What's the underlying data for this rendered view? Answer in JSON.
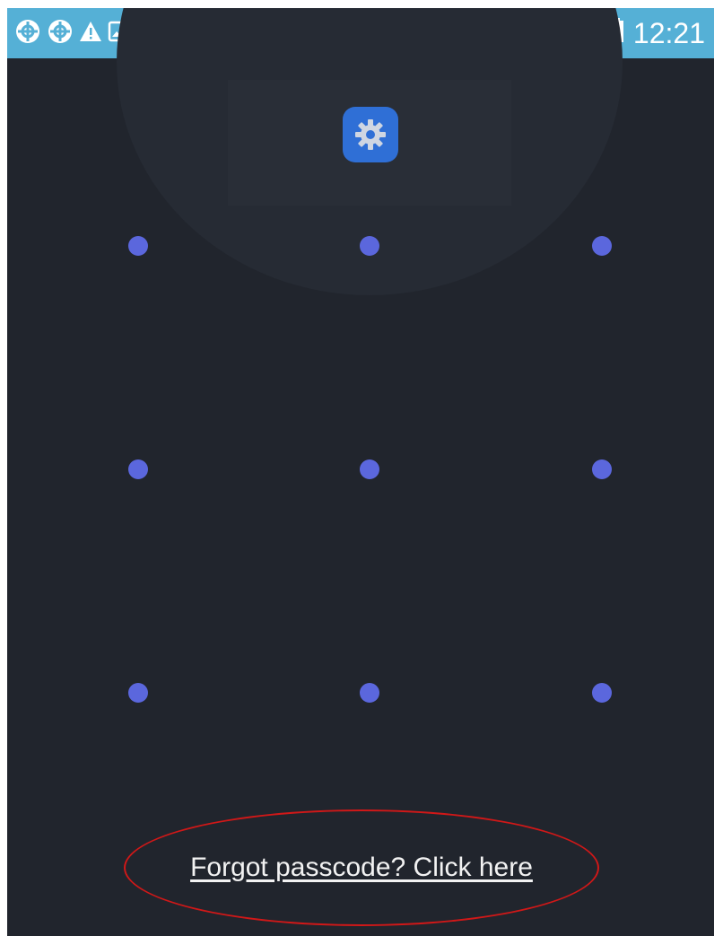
{
  "status_bar": {
    "time": "12:21",
    "left_icons": [
      "crosshair-circle-icon",
      "crosshair-circle-icon",
      "warning-icon",
      "image-icon",
      "crosshair-circle-icon",
      "c-app-icon",
      "c-app-icon",
      "c-app-icon"
    ],
    "right_icons": [
      "wifi-icon",
      "signal-icon",
      "battery-icon"
    ],
    "background_color": "#55b0d6"
  },
  "lock_screen": {
    "app_icon": "settings-gear-icon",
    "pattern_dots": 9,
    "dot_color": "#5b67dd",
    "background_color": "#21252d",
    "forgot_link": "Forgot passcode? Click here",
    "highlight_color": "#d01818"
  }
}
